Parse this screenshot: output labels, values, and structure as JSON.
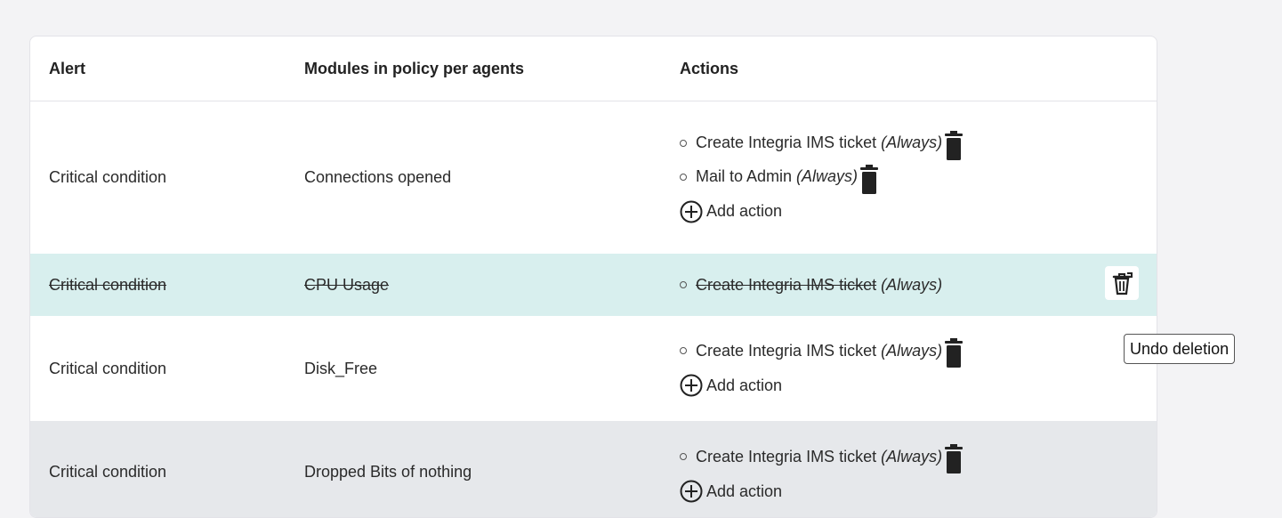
{
  "table": {
    "headers": {
      "alert": "Alert",
      "modules": "Modules in policy per agents",
      "actions": "Actions"
    },
    "rows": [
      {
        "alert": "Critical condition",
        "module": "Connections opened",
        "actions": [
          {
            "name": "Create Integria IMS ticket",
            "frequency": "(Always)"
          },
          {
            "name": "Mail to Admin",
            "frequency": "(Always)"
          }
        ],
        "add_action": "Add action"
      },
      {
        "alert": "Critical condition",
        "module": "CPU Usage",
        "actions": [
          {
            "name": "Create Integria IMS ticket",
            "frequency": "(Always)"
          }
        ],
        "state": "deleted"
      },
      {
        "alert": "Critical condition",
        "module": "Disk_Free",
        "actions": [
          {
            "name": "Create Integria IMS ticket",
            "frequency": "(Always)"
          }
        ],
        "add_action": "Add action"
      },
      {
        "alert": "Critical condition",
        "module": "Dropped Bits of nothing",
        "actions": [
          {
            "name": "Create Integria IMS ticket",
            "frequency": "(Always)"
          }
        ],
        "add_action": "Add action"
      }
    ]
  },
  "tooltip": {
    "text": "Undo deletion"
  },
  "colors": {
    "deleted_row_bg": "#d8efee",
    "alt_row_bg": "#e6e8eb",
    "icon": "#222222"
  },
  "icons": {
    "delete": "trash-icon",
    "add": "plus-circle-icon",
    "undo": "undo-trash-icon"
  }
}
